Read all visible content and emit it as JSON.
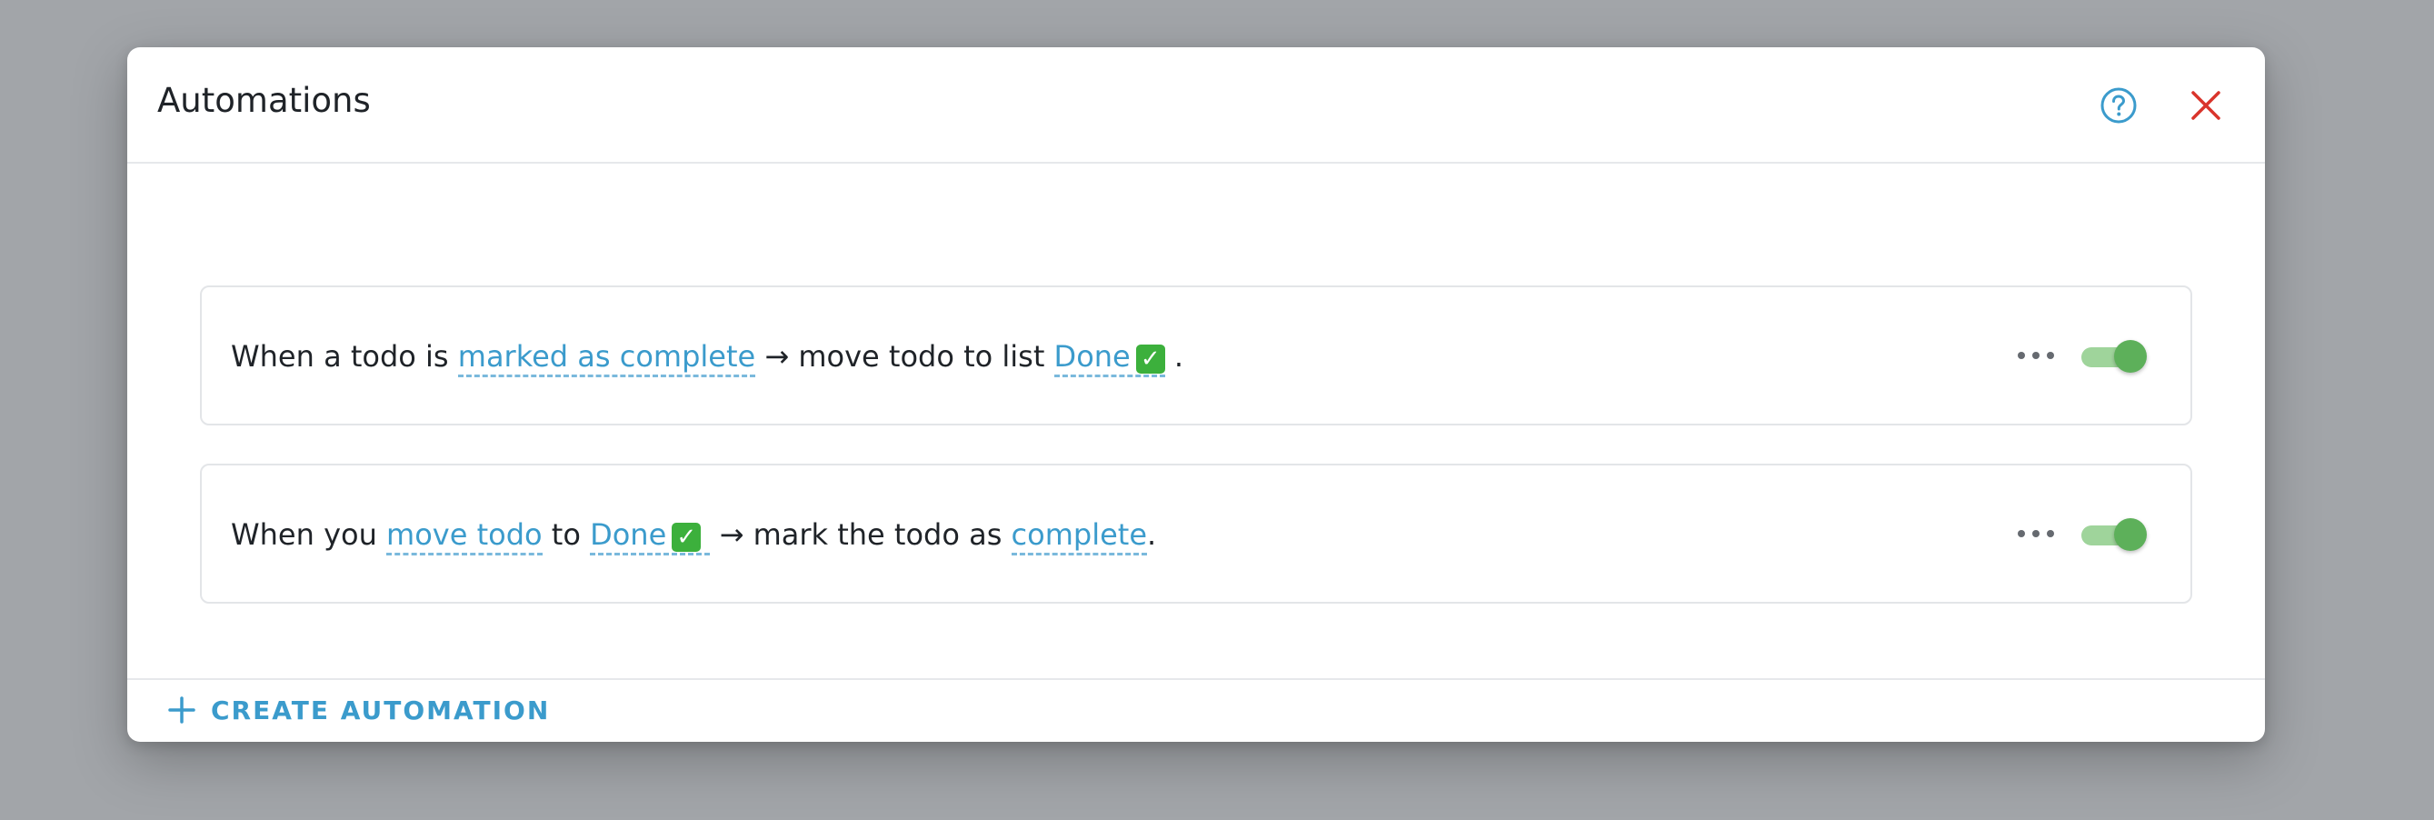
{
  "modal": {
    "title": "Automations",
    "help_icon": "help-circle-icon",
    "close_icon": "close-icon",
    "accent_color": "#3b9bcc",
    "close_color": "#d9342b"
  },
  "rules": [
    {
      "parts": [
        {
          "text": "When a todo is ",
          "link": false
        },
        {
          "text": "marked as complete",
          "link": true
        },
        {
          "text": " → move todo to list ",
          "link": false
        },
        {
          "text": "Done",
          "link": true,
          "emoji": "✓"
        },
        {
          "text": ".",
          "link": false
        }
      ],
      "enabled": true
    },
    {
      "parts": [
        {
          "text": "When you ",
          "link": false
        },
        {
          "text": "move todo",
          "link": true
        },
        {
          "text": " to ",
          "link": false
        },
        {
          "text": "Done",
          "link": true,
          "emoji": "✓"
        },
        {
          "text": " → mark the todo as ",
          "link": false
        },
        {
          "text": "complete",
          "link": true
        },
        {
          "text": ".",
          "link": false
        }
      ],
      "enabled": true
    }
  ],
  "footer": {
    "create_label": "CREATE AUTOMATION",
    "plus_icon": "plus-icon"
  },
  "colors": {
    "toggle_on": "#5db05a",
    "link": "#3b9bcc"
  }
}
